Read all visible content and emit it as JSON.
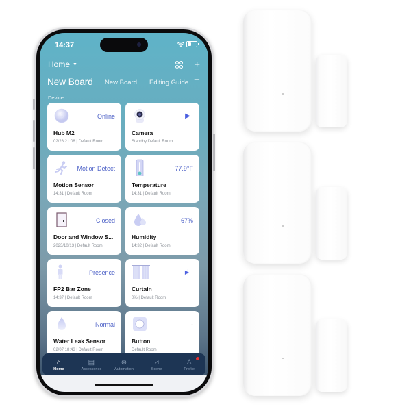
{
  "status_bar": {
    "time": "14:37",
    "signal": "....",
    "wifi_icon": "wifi-icon",
    "battery_icon": "battery-icon"
  },
  "header": {
    "home_label": "Home",
    "home_caret_icon": "caret-down-icon",
    "grid_icon": "grid-icon",
    "add_icon": "+"
  },
  "tabs": {
    "active": "New Board",
    "items": [
      "New Board",
      "Editing Guide"
    ],
    "menu_icon": "☰"
  },
  "section_label": "Device",
  "devices": [
    {
      "name": "Hub M2",
      "status": "Online",
      "sub": "02/28 21:08 | Default Room",
      "icon": "hub-icon"
    },
    {
      "name": "Camera",
      "status": "▶",
      "sub": "Standby|Default Room",
      "icon": "camera-icon"
    },
    {
      "name": "Motion Sensor",
      "status": "Motion Detect",
      "sub": "14:31 | Default Room",
      "icon": "motion-icon"
    },
    {
      "name": "Temperature",
      "status": "77.9°F",
      "sub": "14:31 | Default Room",
      "icon": "thermometer-icon"
    },
    {
      "name": "Door and Window S...",
      "status": "Closed",
      "sub": "2023/10/13 | Default Room",
      "icon": "door-icon"
    },
    {
      "name": "Humidity",
      "status": "67%",
      "sub": "14:32 | Default Room",
      "icon": "humidity-icon"
    },
    {
      "name": "FP2 Bar Zone",
      "status": "Presence",
      "sub": "14:37 | Default Room",
      "icon": "person-icon"
    },
    {
      "name": "Curtain",
      "status": "▶▏",
      "sub": "0% | Default Room",
      "icon": "curtain-icon"
    },
    {
      "name": "Water Leak Sensor",
      "status": "Normal",
      "sub": "02/07 18:43 | Default Room",
      "icon": "water-drop-icon"
    },
    {
      "name": "Button",
      "status": "-",
      "sub": "Default Room",
      "icon": "button-icon"
    }
  ],
  "tabbar": [
    {
      "label": "Home",
      "icon": "⌂",
      "active": true
    },
    {
      "label": "Accessories",
      "icon": "▤",
      "active": false
    },
    {
      "label": "Automation",
      "icon": "⊛",
      "active": false
    },
    {
      "label": "Scene",
      "icon": "⊿",
      "active": false
    },
    {
      "label": "Profile",
      "icon": "♙",
      "active": false,
      "badge": true
    }
  ],
  "colors": {
    "accent": "#5064c8",
    "tabbar_bg": "#1d3554",
    "badge": "#e53030"
  }
}
